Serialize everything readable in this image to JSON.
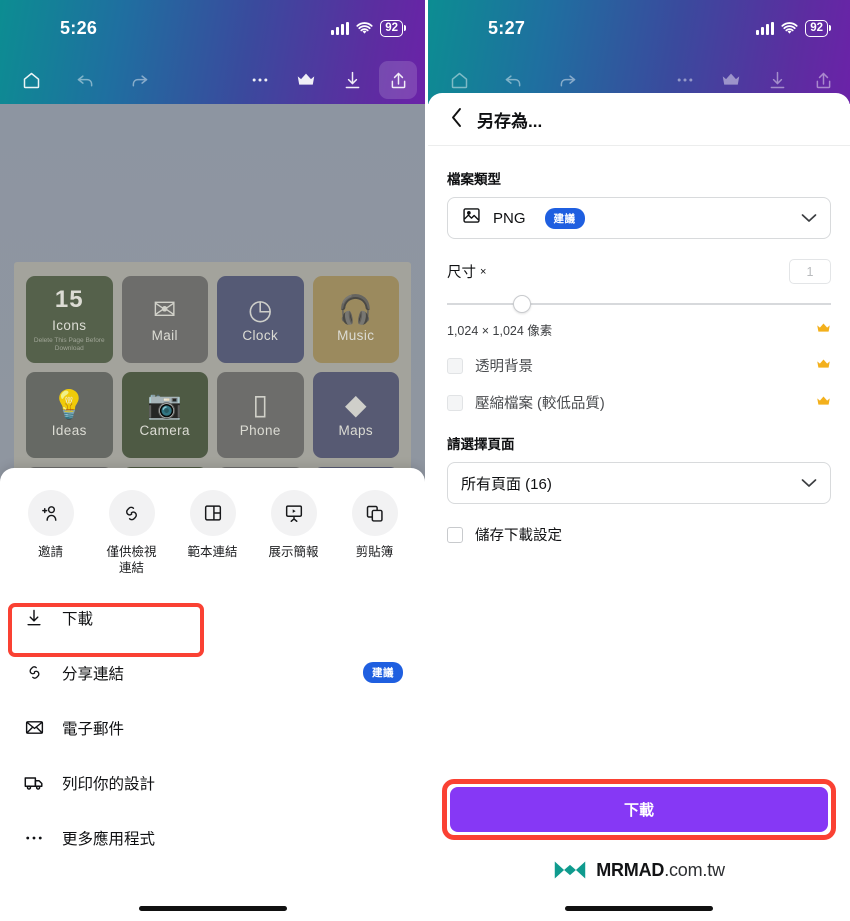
{
  "left": {
    "status": {
      "time": "5:26",
      "battery": "92",
      "wifi_icon": "wifi-icon",
      "signal_icon": "cellular-signal-icon"
    },
    "toolbar": {
      "home_icon": "home-icon",
      "undo_icon": "undo-icon",
      "redo_icon": "redo-icon",
      "more_icon": "more-horizontal-icon",
      "crown_icon": "crown-icon",
      "download_icon": "download-icon",
      "share_icon": "share-upload-icon"
    },
    "canvas": {
      "tiles": [
        {
          "title": "Icons",
          "number": "15",
          "sub": "Delete This Page Before Download",
          "glyph": "",
          "color": "#55614b",
          "icon_name": "count-badge-tile"
        },
        {
          "title": "Mail",
          "glyph": "✉",
          "color": "#6d6d6b",
          "icon_name": "mail-icon-tile"
        },
        {
          "title": "Clock",
          "glyph": "◷",
          "color": "#555a75",
          "icon_name": "clock-icon-tile"
        },
        {
          "title": "Music",
          "glyph": "🎧",
          "color": "#9b8a5e",
          "icon_name": "headphones-icon-tile"
        },
        {
          "title": "Ideas",
          "glyph": "💡",
          "color": "#666964",
          "icon_name": "lightbulb-icon-tile"
        },
        {
          "title": "Camera",
          "glyph": "📷",
          "color": "#4e5a44",
          "icon_name": "camera-icon-tile"
        },
        {
          "title": "Phone",
          "glyph": "▯",
          "color": "#6d6d6b",
          "icon_name": "phone-icon-tile"
        },
        {
          "title": "Maps",
          "glyph": "◆",
          "color": "#575a73",
          "icon_name": "maps-icon-tile"
        }
      ],
      "partial_row_colors": [
        "#6d6d6b",
        "#4e5a44",
        "#6d6d6b",
        "#575a73"
      ]
    },
    "sheet": {
      "quick_actions": [
        {
          "label": "邀請",
          "icon": "add-person-icon"
        },
        {
          "label": "僅供檢視連結",
          "icon": "link-icon"
        },
        {
          "label": "範本連結",
          "icon": "template-layout-icon"
        },
        {
          "label": "展示簡報",
          "icon": "presentation-icon"
        },
        {
          "label": "剪貼簿",
          "icon": "copy-clipboard-icon"
        }
      ],
      "menu": [
        {
          "label": "下載",
          "icon": "download-icon",
          "badge": "",
          "highlighted": true
        },
        {
          "label": "分享連結",
          "icon": "link-icon",
          "badge": "建議",
          "highlighted": false
        },
        {
          "label": "電子郵件",
          "icon": "envelope-icon",
          "badge": "",
          "highlighted": false
        },
        {
          "label": "列印你的設計",
          "icon": "truck-delivery-icon",
          "badge": "",
          "highlighted": false
        },
        {
          "label": "更多應用程式",
          "icon": "more-horizontal-icon",
          "badge": "",
          "highlighted": false
        }
      ]
    }
  },
  "right": {
    "status": {
      "time": "5:27",
      "battery": "92"
    },
    "header": {
      "back_icon": "chevron-left-icon",
      "title": "另存為..."
    },
    "filetype": {
      "label": "檔案類型",
      "icon": "image-file-icon",
      "value": "PNG",
      "badge": "建議",
      "chevron_icon": "chevron-down-icon"
    },
    "size": {
      "label": "尺寸",
      "multiplier_symbol": "×",
      "input_value": "1",
      "pixels": "1,024 × 1,024 像素",
      "crown_icon": "crown-icon"
    },
    "options": [
      {
        "label": "透明背景",
        "checked": false,
        "disabled": true,
        "crown": true
      },
      {
        "label": "壓縮檔案 (較低品質)",
        "checked": false,
        "disabled": true,
        "crown": true
      }
    ],
    "pages": {
      "label": "請選擇頁面",
      "value": "所有頁面 (16)",
      "chevron_icon": "chevron-down-icon"
    },
    "save_settings": {
      "label": "儲存下載設定",
      "checked": false
    },
    "download_button": {
      "label": "下載",
      "color": "#8638f5",
      "highlight_color": "#fa4133"
    },
    "watermark": {
      "brand": "MRMAD",
      "suffix": ".com.tw",
      "logo_icon": "mrmad-logo-icon",
      "logo_color": "#0f9b8e"
    }
  }
}
